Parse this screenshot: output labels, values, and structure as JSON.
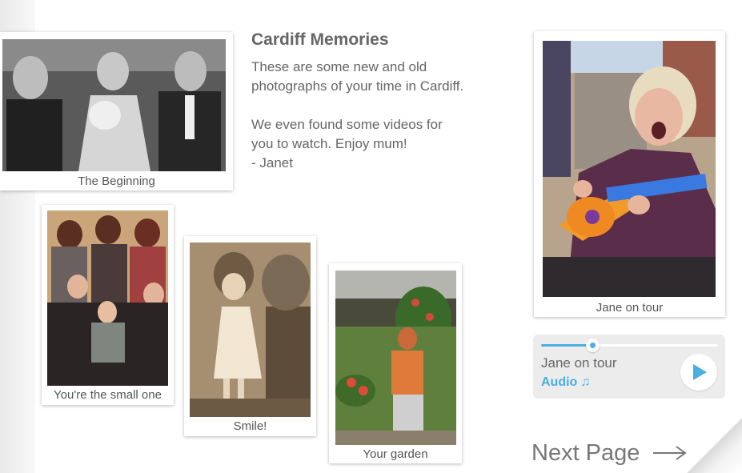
{
  "intro": {
    "title": "Cardiff Memories",
    "lines": [
      "These are some new and old",
      "photographs of your time in Cardiff.",
      "",
      "We even found some videos for",
      "you to watch. Enjoy mum!",
      "- Janet"
    ]
  },
  "photos": [
    {
      "caption": "The Beginning"
    },
    {
      "caption": "You're the small one"
    },
    {
      "caption": "Smile!"
    },
    {
      "caption": "Your garden"
    },
    {
      "caption": "Jane on tour"
    }
  ],
  "audio": {
    "title": "Jane on tour",
    "subtitle": "Audio",
    "progress": 0.29,
    "icon": "music-note-icon",
    "play_icon": "play-icon",
    "accent": "#4aaee0"
  },
  "navigation": {
    "next_label": "Next Page",
    "icon": "arrow-right-icon"
  }
}
